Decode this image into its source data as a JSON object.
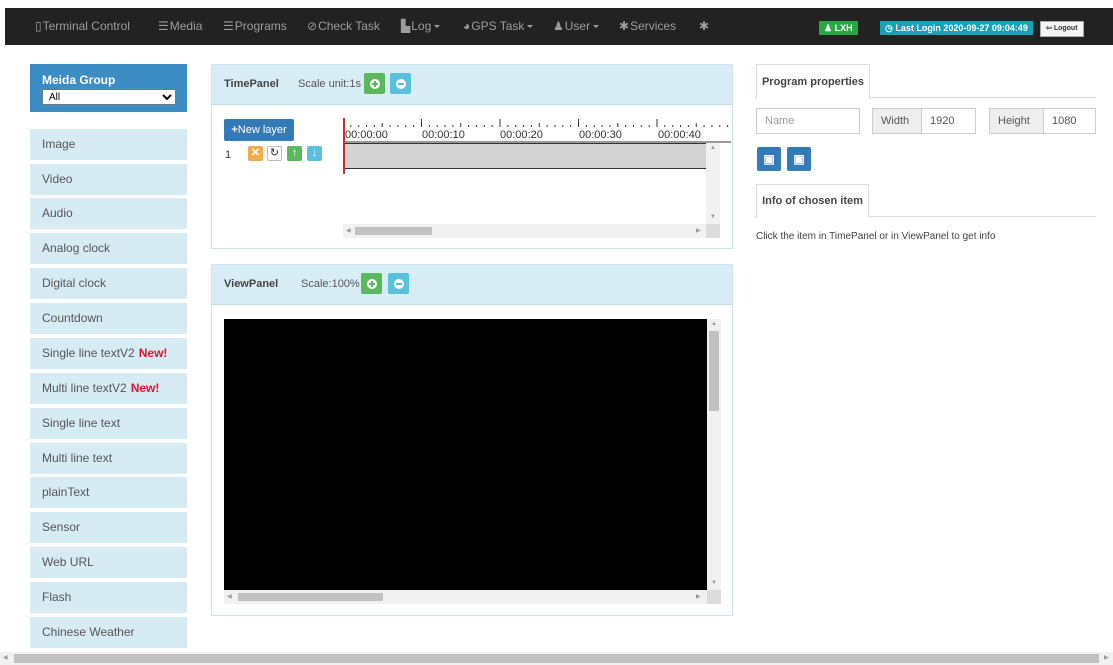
{
  "nav": {
    "terminal_control": "Terminal Control",
    "media": "Media",
    "programs": "Programs",
    "check_task": "Check Task",
    "log": "Log",
    "gps_task": "GPS Task",
    "user": "User",
    "services": "Services",
    "username": "LXH",
    "last_login": "Last Login  2020-09-27 09:04:49",
    "logout": "Logout"
  },
  "sidebar": {
    "group_label": "Meida Group",
    "group_select": "All",
    "items": [
      {
        "label": "Image",
        "badge": ""
      },
      {
        "label": "Video",
        "badge": ""
      },
      {
        "label": "Audio",
        "badge": ""
      },
      {
        "label": "Analog clock",
        "badge": ""
      },
      {
        "label": "Digital clock",
        "badge": ""
      },
      {
        "label": "Countdown",
        "badge": ""
      },
      {
        "label": "Single line textV2",
        "badge": "New!"
      },
      {
        "label": "Multi line textV2",
        "badge": "New!"
      },
      {
        "label": "Single line text",
        "badge": ""
      },
      {
        "label": "Multi line text",
        "badge": ""
      },
      {
        "label": "plainText",
        "badge": ""
      },
      {
        "label": "Sensor",
        "badge": ""
      },
      {
        "label": "Web URL",
        "badge": ""
      },
      {
        "label": "Flash",
        "badge": ""
      },
      {
        "label": "Chinese Weather",
        "badge": ""
      }
    ]
  },
  "time_panel": {
    "title": "TimePanel",
    "scale": "Scale unit:1s",
    "new_layer": "New layer",
    "layer_number": "1",
    "ticks": [
      "00:00:00",
      "00:00:10",
      "00:00:20",
      "00:00:30",
      "00:00:40"
    ]
  },
  "view_panel": {
    "title": "ViewPanel",
    "scale": "Scale:100%"
  },
  "properties": {
    "tab": "Program properties",
    "name_placeholder": "Name",
    "width_label": "Width",
    "width_value": "1920",
    "height_label": "Height",
    "height_value": "1080",
    "info_tab": "Info of chosen item",
    "info_text": "Click the item in TimePanel or in ViewPanel to get info"
  },
  "colors": {
    "nav_bg": "#222222",
    "sidebar_item_bg": "#d7ebf5",
    "media_group_bg": "#3c8dc4",
    "panel_head_bg": "#d9edf7",
    "btn_green": "#5cb85c",
    "btn_info": "#5bc0de",
    "btn_primary": "#337ab7",
    "btn_warning": "#f0ad4e",
    "user_badge": "#28a745",
    "login_badge": "#17a2b8",
    "new_tag": "#e8132b"
  }
}
